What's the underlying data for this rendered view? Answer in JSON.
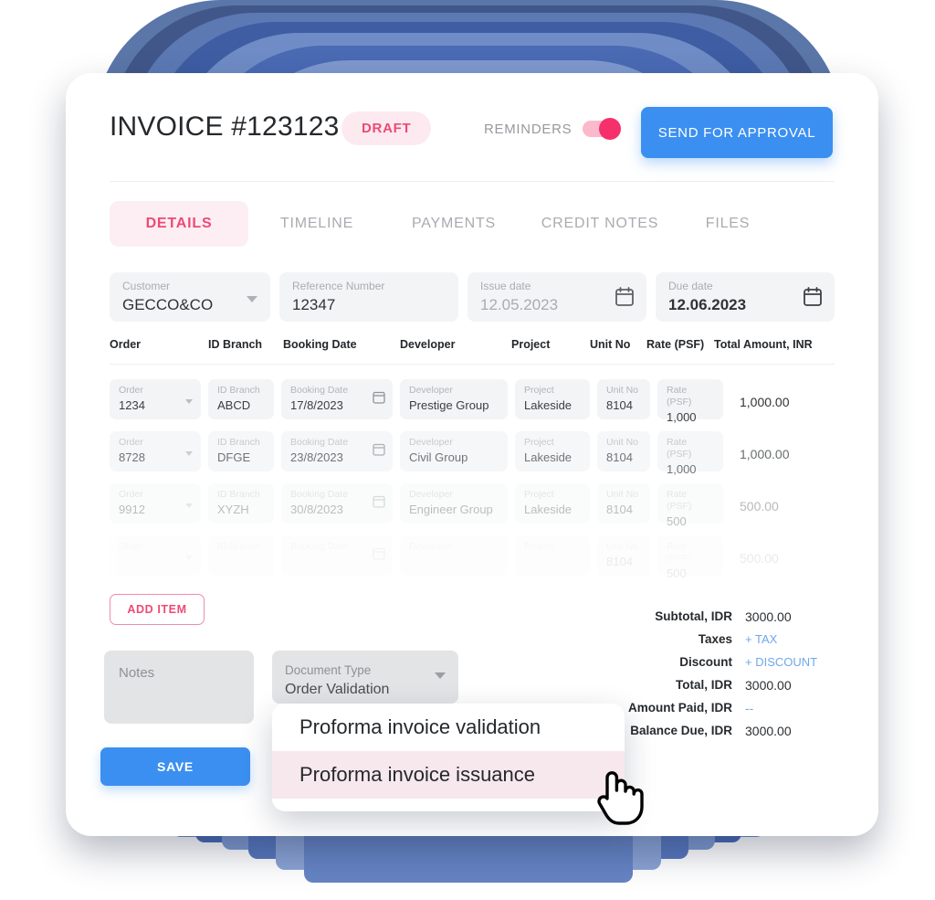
{
  "header": {
    "title": "INVOICE #123123",
    "status_badge": "DRAFT",
    "reminders_label": "REMINDERS",
    "reminders_on": true,
    "send_button": "SEND FOR APPROVAL"
  },
  "tabs": [
    {
      "label": "DETAILS",
      "active": true
    },
    {
      "label": "TIMELINE",
      "active": false
    },
    {
      "label": "PAYMENTS",
      "active": false
    },
    {
      "label": "CREDIT NOTES",
      "active": false
    },
    {
      "label": "FILES",
      "active": false
    }
  ],
  "form": {
    "customer": {
      "label": "Customer",
      "value": "GECCO&CO"
    },
    "reference": {
      "label": "Reference Number",
      "value": "12347"
    },
    "issue_date": {
      "label": "Issue date",
      "value": "12.05.2023"
    },
    "due_date": {
      "label": "Due date",
      "value": "12.06.2023"
    }
  },
  "table": {
    "columns": [
      "Order",
      "ID Branch",
      "Booking Date",
      "Developer",
      "Project",
      "Unit No",
      "Rate (PSF)",
      "Total Amount, INR"
    ],
    "placeholders": {
      "order": "Order",
      "id_branch": "ID Branch",
      "booking_date": "Booking Date",
      "developer": "Developer",
      "project": "Project",
      "unit_no": "Unit No",
      "rate": "Rate (PSF)"
    },
    "rows": [
      {
        "order": "1234",
        "id_branch": "ABCD",
        "booking_date": "17/8/2023",
        "developer": "Prestige Group",
        "project": "Lakeside",
        "unit_no": "8104",
        "rate": "1,000",
        "total": "1,000.00"
      },
      {
        "order": "8728",
        "id_branch": "DFGE",
        "booking_date": "23/8/2023",
        "developer": "Civil Group",
        "project": "Lakeside",
        "unit_no": "8104",
        "rate": "1,000",
        "total": "1,000.00"
      },
      {
        "order": "9912",
        "id_branch": "XYZH",
        "booking_date": "30/8/2023",
        "developer": "Engineer Group",
        "project": "Lakeside",
        "unit_no": "8104",
        "rate": "500",
        "total": "500.00"
      },
      {
        "order": "",
        "id_branch": "",
        "booking_date": "",
        "developer": "",
        "project": "",
        "unit_no": "8104",
        "rate": "500",
        "total": "500.00"
      }
    ]
  },
  "actions": {
    "add_item": "ADD ITEM",
    "save": "SAVE"
  },
  "notes": {
    "placeholder": "Notes",
    "value": ""
  },
  "document_type": {
    "label": "Document Type",
    "value": "Order Validation",
    "options": [
      {
        "label": "Proforma invoice validation",
        "highlighted": false
      },
      {
        "label": "Proforma invoice issuance",
        "highlighted": true
      }
    ]
  },
  "totals": [
    {
      "label": "Subtotal, IDR",
      "value": "3000.00",
      "kind": "text"
    },
    {
      "label": "Taxes",
      "value": "+ TAX",
      "kind": "link"
    },
    {
      "label": "Discount",
      "value": "+ DISCOUNT",
      "kind": "link"
    },
    {
      "label": "Total, IDR",
      "value": "3000.00",
      "kind": "text"
    },
    {
      "label": "Amount Paid, IDR",
      "value": "--",
      "kind": "dash"
    },
    {
      "label": "Balance Due, IDR",
      "value": "3000.00",
      "kind": "text"
    }
  ],
  "colors": {
    "accent_pink": "#ed4a74",
    "accent_blue": "#3b8ff0",
    "toggle_on": "#f5306b",
    "field_bg": "#f3f4f6",
    "backdrop_blue": "#4a6ab4"
  }
}
